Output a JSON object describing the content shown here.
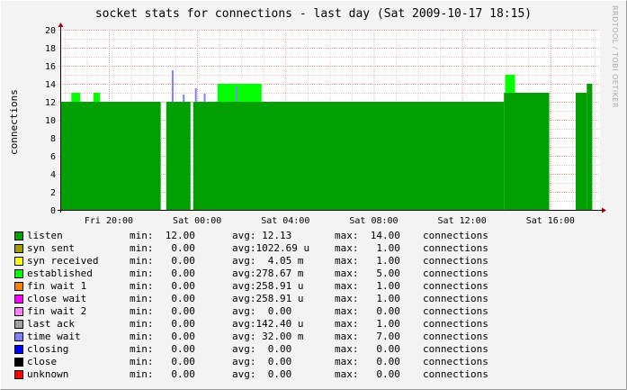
{
  "title": "socket stats for connections - last day (Sat 2009-10-17 18:15)",
  "watermark": "RRDTOOL / TOBI OETIKER",
  "chart_data": {
    "type": "area",
    "title": "socket stats for connections - last day (Sat 2009-10-17 18:15)",
    "ylabel": "connections",
    "ylim": [
      0,
      20
    ],
    "yticks": [
      0,
      2,
      4,
      6,
      8,
      10,
      12,
      14,
      16,
      18,
      20
    ],
    "xlim_hours": [
      17.8,
      42.25
    ],
    "xticks": [
      {
        "label": "Fri 20:00",
        "t": 20
      },
      {
        "label": "Sat 00:00",
        "t": 24
      },
      {
        "label": "Sat 04:00",
        "t": 28
      },
      {
        "label": "Sat 08:00",
        "t": 32
      },
      {
        "label": "Sat 12:00",
        "t": 36
      },
      {
        "label": "Sat 16:00",
        "t": 40
      }
    ],
    "grid": true,
    "stacked": true,
    "listen_segments": [
      {
        "from": 17.8,
        "to": 22.35,
        "value": 12
      },
      {
        "from": 22.6,
        "to": 23.7,
        "value": 12
      },
      {
        "from": 23.82,
        "to": 37.9,
        "value": 12
      },
      {
        "from": 37.9,
        "to": 39.95,
        "value": 13
      },
      {
        "from": 41.15,
        "to": 41.65,
        "value": 13
      },
      {
        "from": 41.65,
        "to": 41.9,
        "value": 14
      }
    ],
    "established_segments": [
      {
        "from": 18.3,
        "to": 18.7,
        "value": 1
      },
      {
        "from": 19.3,
        "to": 19.6,
        "value": 1
      },
      {
        "from": 24.92,
        "to": 26.92,
        "value": 2
      },
      {
        "from": 37.95,
        "to": 38.4,
        "value": 2
      }
    ],
    "time_wait_spikes": [
      {
        "t": 22.85,
        "value": 3.5
      },
      {
        "t": 23.35,
        "value": 0.8
      },
      {
        "t": 23.9,
        "value": 1.5
      },
      {
        "t": 24.3,
        "value": 0.9
      },
      {
        "t": 25.75,
        "value": 1.7
      }
    ],
    "series": [
      {
        "name": "listen",
        "color": "#00a000",
        "min": "12.00",
        "avg": " 12.13",
        "max": "14.00"
      },
      {
        "name": "syn sent",
        "color": "#a0a000",
        "min": " 0.00",
        "avg": "1022.69 u",
        "max": " 1.00"
      },
      {
        "name": "syn received",
        "color": "#ffff00",
        "min": " 0.00",
        "avg": "  4.05 m",
        "max": " 1.00"
      },
      {
        "name": "established",
        "color": "#00ff00",
        "min": " 0.00",
        "avg": "278.67 m",
        "max": " 5.00"
      },
      {
        "name": "fin wait 1",
        "color": "#ff8000",
        "min": " 0.00",
        "avg": "258.91 u",
        "max": " 1.00"
      },
      {
        "name": "close wait",
        "color": "#ff00ff",
        "min": " 0.00",
        "avg": "258.91 u",
        "max": " 1.00"
      },
      {
        "name": "fin wait 2",
        "color": "#ff80ff",
        "min": " 0.00",
        "avg": "  0.00  ",
        "max": " 0.00"
      },
      {
        "name": "last ack",
        "color": "#a0a0a0",
        "min": " 0.00",
        "avg": "142.40 u",
        "max": " 1.00"
      },
      {
        "name": "time wait",
        "color": "#8080ff",
        "min": " 0.00",
        "avg": " 32.00 m",
        "max": " 7.00"
      },
      {
        "name": "closing",
        "color": "#0000ff",
        "min": " 0.00",
        "avg": "  0.00  ",
        "max": " 0.00"
      },
      {
        "name": "close",
        "color": "#000000",
        "min": " 0.00",
        "avg": "  0.00  ",
        "max": " 0.00"
      },
      {
        "name": "unknown",
        "color": "#ff0000",
        "min": " 0.00",
        "avg": "  0.00  ",
        "max": " 0.00"
      }
    ]
  },
  "legend": {
    "min_label": "min:",
    "avg_label": "avg:",
    "max_label": "max:",
    "unit_label": "connections"
  }
}
